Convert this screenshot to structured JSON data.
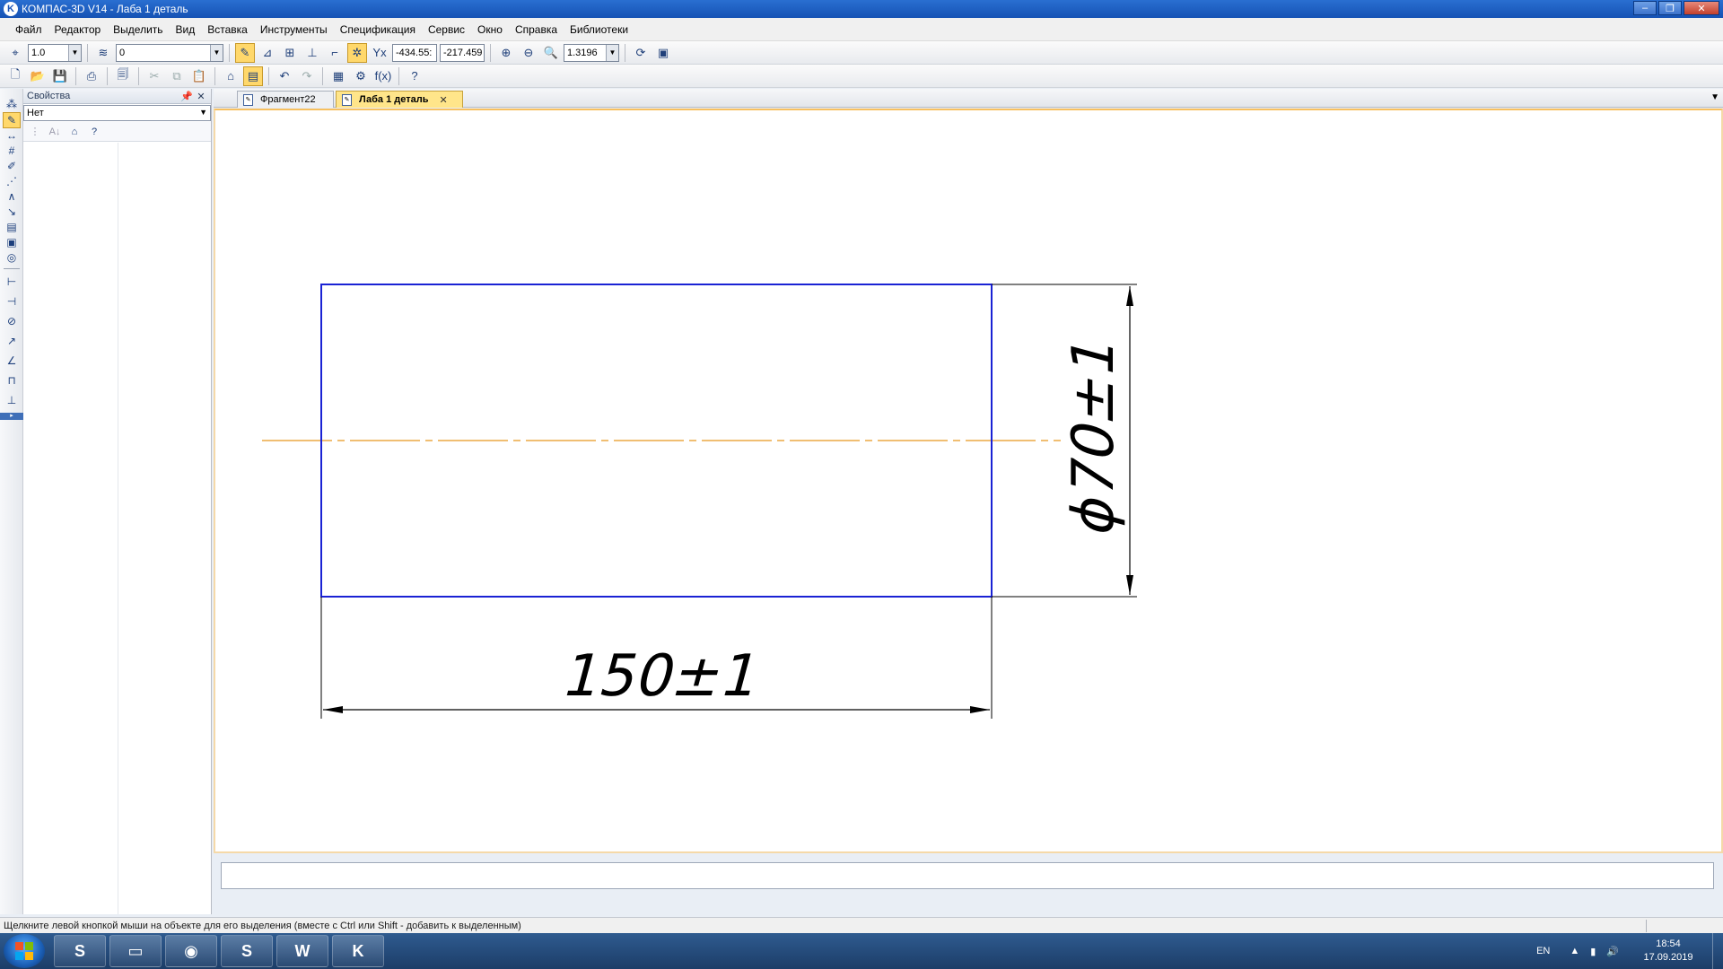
{
  "window": {
    "title": "КОМПАС-3D V14 - Лаба 1 деталь",
    "icon": "kompas-icon",
    "controls": [
      "minimize",
      "maximize",
      "close"
    ]
  },
  "menu": [
    "Файл",
    "Редактор",
    "Выделить",
    "Вид",
    "Вставка",
    "Инструменты",
    "Спецификация",
    "Сервис",
    "Окно",
    "Справка",
    "Библиотеки"
  ],
  "toolbar1": {
    "step_value": "1.0",
    "layer_value": "0",
    "coord_x": "-434.55:",
    "coord_y": "-217.459",
    "zoom_value": "1.3196"
  },
  "properties_panel": {
    "title": "Свойства",
    "selected_value": "Нет"
  },
  "tabs": [
    {
      "label": "Фрагмент22",
      "active": false
    },
    {
      "label": "Лаба 1 деталь",
      "active": true
    }
  ],
  "drawing": {
    "dim_diameter_text": "ϕ70±1",
    "dim_length_text": "150±1",
    "outline_color": "#1a22d4",
    "axis_color": "#e8961e",
    "dim_color": "#000000"
  },
  "status": {
    "hint": "Щелкните левой кнопкой мыши на объекте для его выделения (вместе с Ctrl или Shift - добавить к выделенным)"
  },
  "taskbar": {
    "apps": [
      "sublime-icon",
      "explorer-icon",
      "chrome-icon",
      "skype-icon",
      "word-icon",
      "kompas-icon"
    ],
    "lang": "EN",
    "time": "18:54",
    "date": "17.09.2019"
  }
}
